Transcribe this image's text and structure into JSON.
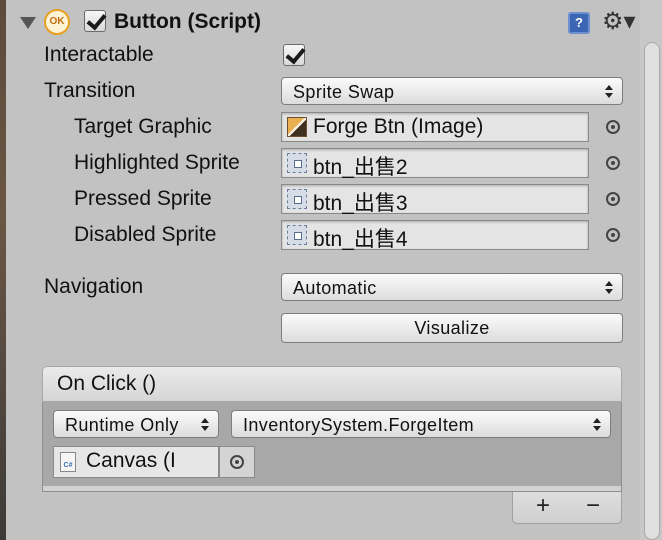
{
  "component": {
    "title": "Button (Script)",
    "enabled": true,
    "ok_badge": "OK",
    "help_glyph": "?",
    "settings_glyph": "⚙▾"
  },
  "fields": {
    "interactable": {
      "label": "Interactable",
      "checked": true
    },
    "transition": {
      "label": "Transition",
      "value": "Sprite Swap"
    },
    "target_graphic": {
      "label": "Target Graphic",
      "value": "Forge Btn (Image)",
      "icon": "image-icon"
    },
    "highlighted_sprite": {
      "label": "Highlighted Sprite",
      "value": "btn_出售2",
      "icon": "sprite-icon"
    },
    "pressed_sprite": {
      "label": "Pressed Sprite",
      "value": "btn_出售3",
      "icon": "sprite-icon"
    },
    "disabled_sprite": {
      "label": "Disabled Sprite",
      "value": "btn_出售4",
      "icon": "sprite-icon"
    },
    "navigation": {
      "label": "Navigation",
      "value": "Automatic"
    },
    "visualize": {
      "label": "Visualize"
    }
  },
  "on_click": {
    "title": "On Click ()",
    "call_state": "Runtime Only",
    "function": "InventorySystem.ForgeItem",
    "target_object": "Canvas (I",
    "target_icon_text": "C#",
    "add_label": "+",
    "remove_label": "−"
  }
}
